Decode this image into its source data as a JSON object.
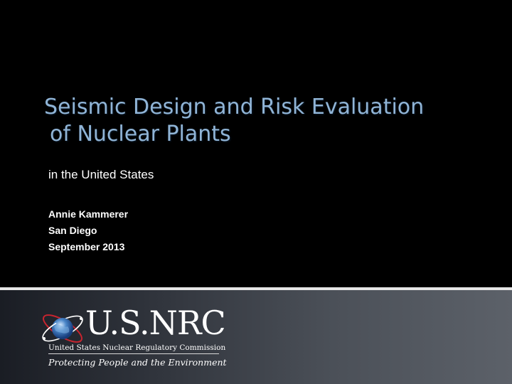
{
  "slide": {
    "title_line1": "Seismic Design and Risk Evaluation",
    "title_line2": "of Nuclear Plants",
    "subtitle": "in the United States",
    "author": "Annie Kammerer",
    "location": "San Diego",
    "date": "September 2013"
  },
  "logo": {
    "wordmark": "U.S.NRC",
    "agency_name": "United States Nuclear Regulatory Commission",
    "tagline": "Protecting People and the Environment",
    "icon": "atom-globe-icon"
  },
  "colors": {
    "background": "#000000",
    "title": "#90b4d6",
    "text": "#ffffff",
    "band_dark": "#1a1d24",
    "band_light": "#5c6169",
    "divider": "#e6e6e6"
  }
}
